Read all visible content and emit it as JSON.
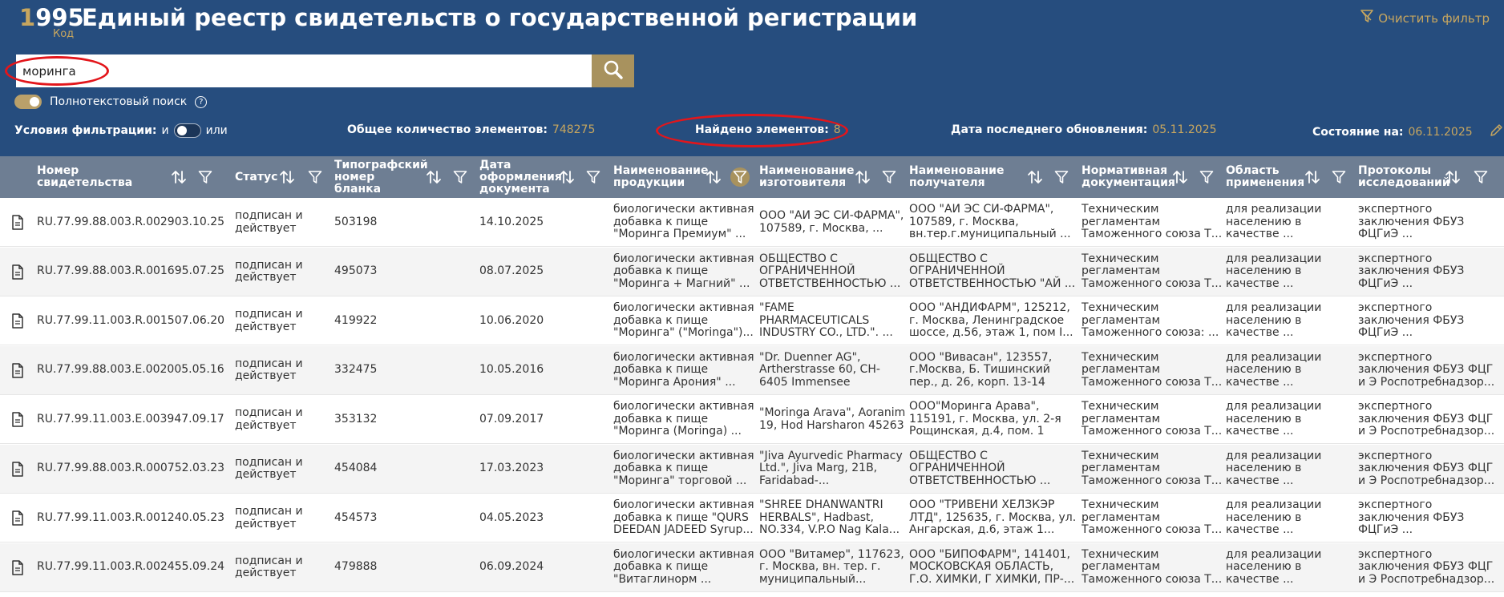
{
  "header": {
    "code_first": "1",
    "code_rest": "995",
    "code_caption": "Код",
    "title": "Единый реестр свидетельств о государственной регистрации",
    "clear_filter": "Очистить фильтр",
    "icon": "filter-clear-icon"
  },
  "search": {
    "value": "моринга",
    "button_icon": "search-icon"
  },
  "fulltext": {
    "label": "Полнотекстовый поиск",
    "enabled": true,
    "help_icon": "help-icon"
  },
  "filter_conditions": {
    "label": "Условия фильтрации:",
    "and": "и",
    "or": "или"
  },
  "stats": {
    "total_label": "Общее количество элементов:",
    "total_value": "748275",
    "found_label": "Найдено элементов:",
    "found_value": "8",
    "updated_label": "Дата последнего обновления:",
    "updated_value": "05.11.2025",
    "state_label": "Состояние на:",
    "state_value": "06.11.2025",
    "edit_icon": "edit-icon"
  },
  "columns": [
    {
      "label": "Номер свидетельства"
    },
    {
      "label": "Статус"
    },
    {
      "label": "Типографский номер бланка"
    },
    {
      "label": "Дата оформления документа"
    },
    {
      "label": "Наименование продукции"
    },
    {
      "label": "Наименование изготовителя"
    },
    {
      "label": "Наименование получателя"
    },
    {
      "label": "Нормативная документация"
    },
    {
      "label": "Область применения"
    },
    {
      "label": "Протоколы исследований"
    }
  ],
  "rows": [
    {
      "number": "RU.77.99.88.003.R.002903.10.25",
      "status": "подписан и действует",
      "blank": "503198",
      "date": "14.10.2025",
      "product": "биологически активная добавка к пище \"Моринга Премиум\" ...",
      "manufacturer": "ООО \"АЙ ЭС СИ-ФАРМА\", 107589, г. Москва, ...",
      "recipient": "ООО \"АЙ ЭС СИ-ФАРМА\", 107589, г. Москва, вн.тер.г.муниципальный ...",
      "normative": "Техническим регламентам Таможенного союза Т...",
      "area": "для реализации населению в качестве ...",
      "protocols": "экспертного заключения ФБУЗ ФЦГиЭ ..."
    },
    {
      "number": "RU.77.99.88.003.R.001695.07.25",
      "status": "подписан и действует",
      "blank": "495073",
      "date": "08.07.2025",
      "product": "биологически активная добавка к пище \"Моринга + Магний\" ...",
      "manufacturer": "ОБЩЕСТВО С ОГРАНИЧЕННОЙ ОТВЕТСТВЕННОСТЬЮ ...",
      "recipient": "ОБЩЕСТВО С ОГРАНИЧЕННОЙ ОТВЕТСТВЕННОСТЬЮ \"АЙ ...",
      "normative": "Техническим регламентам Таможенного союза Т...",
      "area": "для реализации населению в качестве ...",
      "protocols": "экспертного заключения ФБУЗ ФЦГиЭ ..."
    },
    {
      "number": "RU.77.99.11.003.R.001507.06.20",
      "status": "подписан и действует",
      "blank": "419922",
      "date": "10.06.2020",
      "product": "биологически активная добавка к пище \"Моринга\" (\"Moringa\")...",
      "manufacturer": "\"FAME PHARMACEUTICALS INDUSTRY CO., LTD.\". ...",
      "recipient": "ООО \"АНДИФАРМ\", 125212, г. Москва, Ленинградское шоссе, д.56, этаж 1, пом I...",
      "normative": "Техническим регламентам Таможенного союза: ...",
      "area": "для реализации населению в качестве ...",
      "protocols": "экспертного заключения ФБУЗ ФЦГиЭ ..."
    },
    {
      "number": "RU.77.99.88.003.E.002005.05.16",
      "status": "подписан и действует",
      "blank": "332475",
      "date": "10.05.2016",
      "product": "биологически активная добавка к пище \"Моринга Арония\" ...",
      "manufacturer": "\"Dr. Duenner AG\", Artherstrasse 60, CH-6405 Immensee",
      "recipient": "ООО \"Вивасан\", 123557, г.Москва, Б. Тишинский пер., д. 26, корп. 13-14",
      "normative": "Техническим регламентам Таможенного союза Т...",
      "area": "для реализации населению в качестве ...",
      "protocols": "экспертного заключения ФБУЗ ФЦГ и Э Роспотребнадзор..."
    },
    {
      "number": "RU.77.99.11.003.E.003947.09.17",
      "status": "подписан и действует",
      "blank": "353132",
      "date": "07.09.2017",
      "product": "биологически активная добавка к пище \"Моринга (Moringa) ...",
      "manufacturer": "\"Moringa Arava\", Aoranim 19, Hod Harsharon 45263",
      "recipient": "ООО\"Моринга Арава\", 115191, г. Москва, ул. 2-я Рощинская, д.4, пом. 1",
      "normative": "Техническим регламентам Таможенного союза Т...",
      "area": "для реализации населению в качестве ...",
      "protocols": "экспертного заключения ФБУЗ ФЦГ и Э Роспотребнадзор..."
    },
    {
      "number": "RU.77.99.88.003.R.000752.03.23",
      "status": "подписан и действует",
      "blank": "454084",
      "date": "17.03.2023",
      "product": "биологически активная добавка к пище \"Моринга\" торговой ...",
      "manufacturer": "\"Jiva Ayurvedic Pharmacy Ltd.\", Jiva Marg, 21B, Faridabad-...",
      "recipient": "ОБЩЕСТВО С ОГРАНИЧЕННОЙ ОТВЕТСТВЕННОСТЬЮ ...",
      "normative": "Техническим регламентам Таможенного союза Т...",
      "area": "для реализации населению в качестве ...",
      "protocols": "экспертного заключения ФБУЗ ФЦГ и Э Роспотребнадзор..."
    },
    {
      "number": "RU.77.99.11.003.R.001240.05.23",
      "status": "подписан и действует",
      "blank": "454573",
      "date": "04.05.2023",
      "product": "биологически активная добавка к пище \"QURS DEEDAN JADEED Syrup...",
      "manufacturer": "\"SHREE DHANWANTRI HERBALS\", Hadbast, NO.334, V.P.O Nag Kala...",
      "recipient": "ООО \"ТРИВЕНИ ХЕЛЗКЭР ЛТД\", 125635, г. Москва, ул. Ангарская, д.6, этаж 1...",
      "normative": "Техническим регламентам Таможенного союза Т...",
      "area": "для реализации населению в качестве ...",
      "protocols": "экспертного заключения ФБУЗ ФЦГиЭ ..."
    },
    {
      "number": "RU.77.99.11.003.R.002455.09.24",
      "status": "подписан и действует",
      "blank": "479888",
      "date": "06.09.2024",
      "product": "биологически активная добавка к пище \"Витаглинорм ...",
      "manufacturer": "ООО \"Витамер\", 117623, г. Москва, вн. тер. г. муниципальный...",
      "recipient": "ООО \"БИПОФАРМ\", 141401, МОСКОВСКАЯ ОБЛАСТЬ, Г.О. ХИМКИ, Г ХИМКИ, ПР-...",
      "normative": "Техническим регламентам Таможенного союза Т...",
      "area": "для реализации населению в качестве ...",
      "protocols": "экспертного заключения ФБУЗ ФЦГ и Э Роспотребнадзор..."
    }
  ],
  "colors": {
    "header_bg": "#264d7e",
    "accent": "#c7a65f",
    "table_head": "#6e7e93",
    "highlight": "#e3161b"
  }
}
